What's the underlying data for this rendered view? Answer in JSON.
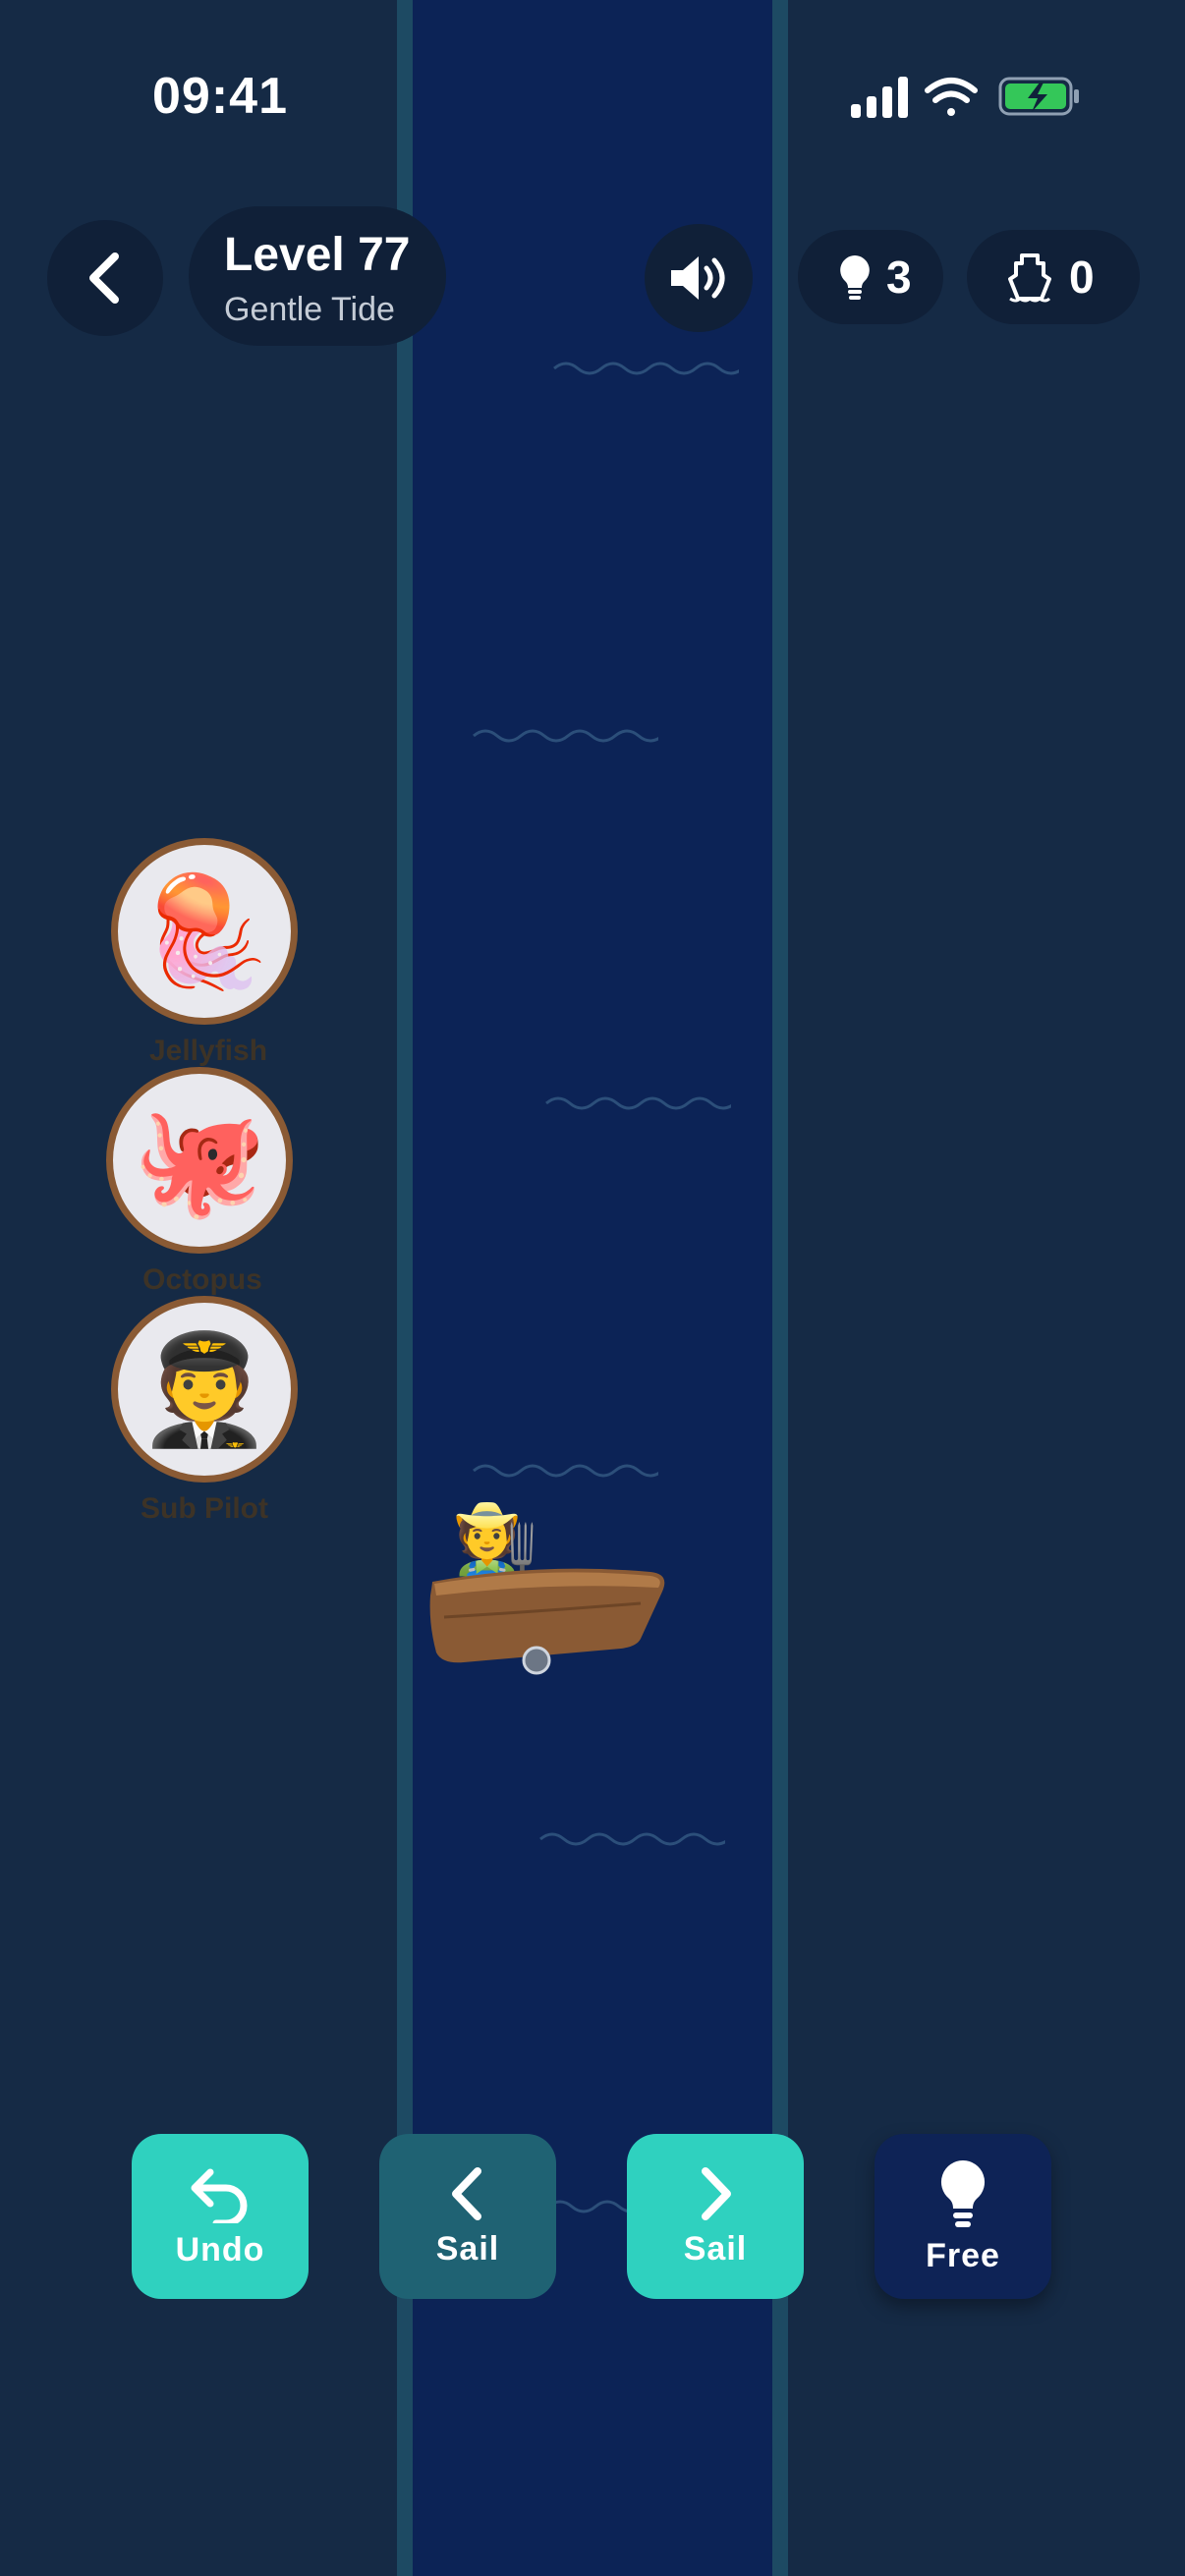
{
  "status_bar": {
    "time": "09:41"
  },
  "header": {
    "level_title": "Level 77",
    "level_subtitle": "Gentle Tide",
    "hints_count": "3",
    "boats_count": "0"
  },
  "characters": [
    {
      "name": "Jellyfish",
      "emoji": "🪼"
    },
    {
      "name": "Octopus",
      "emoji": "🐙"
    },
    {
      "name": "Sub Pilot",
      "emoji": "🧑‍✈️"
    }
  ],
  "boat": {
    "passenger_emoji": "🧑‍🌾"
  },
  "controls": {
    "undo_label": "Undo",
    "sail_left_label": "Sail",
    "sail_right_label": "Sail",
    "free_label": "Free"
  },
  "colors": {
    "river": "#0c2356",
    "bank": "#152a45",
    "accent": "#2fd1bf",
    "boat_wood": "#8a5a34"
  }
}
